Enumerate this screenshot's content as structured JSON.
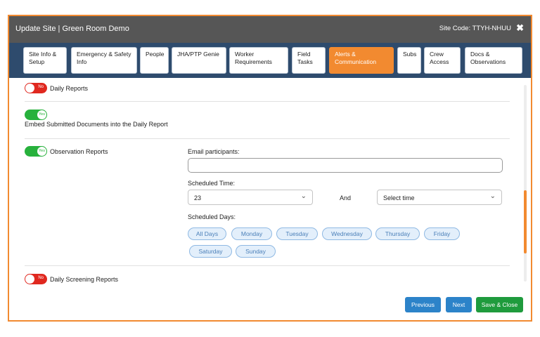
{
  "header": {
    "title": "Update Site | Green Room Demo",
    "site_code": "Site Code: TTYH-NHUU",
    "close_glyph": "✖"
  },
  "tabs": [
    {
      "label": "Site Info & Setup",
      "active": false
    },
    {
      "label": "Emergency & Safety Info",
      "active": false
    },
    {
      "label": "People",
      "active": false
    },
    {
      "label": "JHA/PTP Genie",
      "active": false
    },
    {
      "label": "Worker Requirements",
      "active": false
    },
    {
      "label": "Field Tasks",
      "active": false
    },
    {
      "label": "Alerts & Communication",
      "active": true
    },
    {
      "label": "Subs",
      "active": false
    },
    {
      "label": "Crew Access",
      "active": false
    },
    {
      "label": "Docs & Observations",
      "active": false
    }
  ],
  "sections": {
    "daily_reports": {
      "toggle_text": "No",
      "label": "Daily Reports"
    },
    "embed_docs": {
      "toggle_text": "Yes",
      "label": "Embed Submitted Documents into the Daily Report"
    },
    "observation_reports": {
      "toggle_text": "Yes",
      "label": "Observation Reports",
      "email_label": "Email participants:",
      "email_value": "",
      "time_label": "Scheduled Time:",
      "time_value": "23",
      "and_text": "And",
      "time2_placeholder": "Select time",
      "days_label": "Scheduled Days:",
      "days": [
        "All Days",
        "Monday",
        "Tuesday",
        "Wednesday",
        "Thursday",
        "Friday",
        "Saturday",
        "Sunday"
      ]
    },
    "daily_screening": {
      "toggle_text": "No",
      "label": "Daily Screening Reports"
    }
  },
  "footer": {
    "previous": "Previous",
    "next": "Next",
    "save_close": "Save & Close"
  },
  "icons": {
    "chevron": "⌄"
  },
  "colors": {
    "accent": "#f28a30",
    "header_bg": "#565656",
    "tabbar_bg": "#2e4b6d",
    "toggle_on": "#27b13c",
    "toggle_off": "#e0281f",
    "btn_blue": "#2c83c9",
    "btn_green": "#1f9b3d"
  }
}
